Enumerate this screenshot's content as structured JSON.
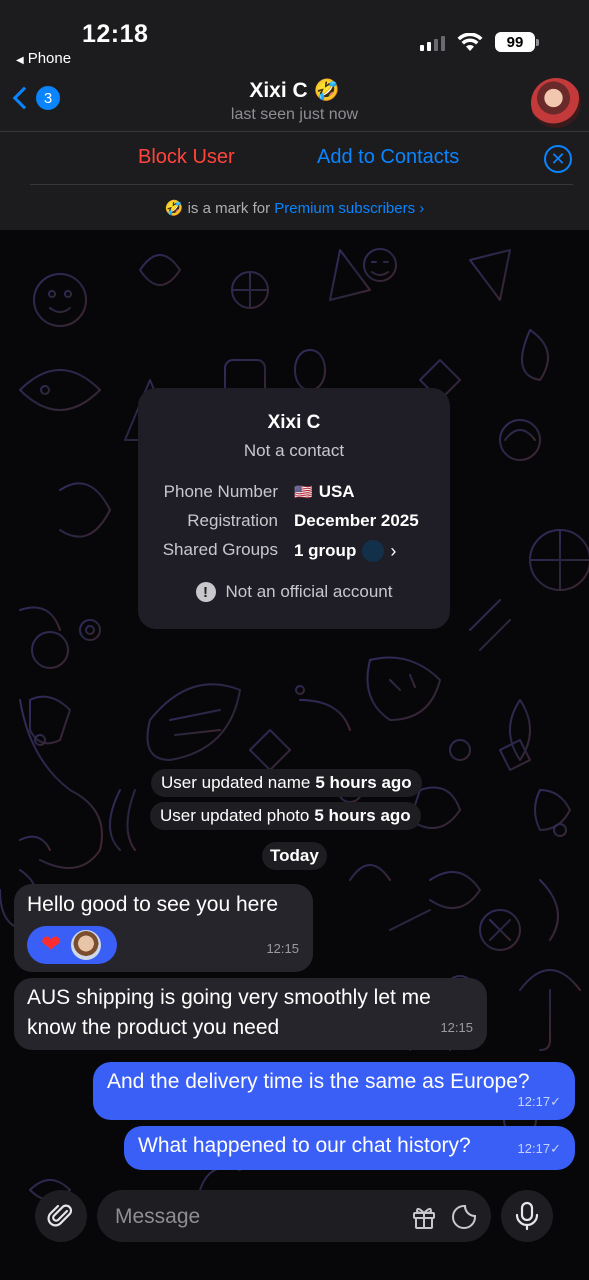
{
  "status_bar": {
    "time": "12:18",
    "back_app": "Phone",
    "battery": "99"
  },
  "header": {
    "unread_count": "3",
    "title": "Xixi C 🤣",
    "subtitle": "last seen just now"
  },
  "actions": {
    "block_label": "Block User",
    "add_label": "Add to Contacts",
    "close_glyph": "✕"
  },
  "premium": {
    "emoji": "🤣",
    "text": "is a mark for",
    "link": "Premium subscribers",
    "arrow": "›"
  },
  "info_card": {
    "name": "Xixi C",
    "status": "Not a contact",
    "rows": [
      {
        "label": "Phone Number",
        "flag": "🇺🇸",
        "value": "USA"
      },
      {
        "label": "Registration",
        "value": "December 2025"
      },
      {
        "label": "Shared Groups",
        "value": "1 group",
        "arrow": "›"
      }
    ],
    "warning": "Not an official account",
    "warning_icon": "!"
  },
  "service_messages": [
    {
      "text": "User updated name",
      "bold": "5 hours ago"
    },
    {
      "text": "User updated photo",
      "bold": "5 hours ago"
    }
  ],
  "date_label": "Today",
  "messages": [
    {
      "direction": "in",
      "text": "Hello good to see you here",
      "time": "12:15",
      "reaction": "❤"
    },
    {
      "direction": "in",
      "text": "AUS shipping is going very smoothly let me know the product you need",
      "time": "12:15"
    },
    {
      "direction": "out",
      "text": "And the delivery time is the same as Europe?",
      "time": "12:17",
      "check": "✓"
    },
    {
      "direction": "out",
      "text": "What happened to our chat history?",
      "time": "12:17",
      "check": "✓"
    }
  ],
  "input": {
    "placeholder": "Message"
  },
  "icons": {
    "attach": "paperclip-icon",
    "gift": "gift-icon",
    "sticker": "sticker-icon",
    "mic": "microphone-icon",
    "warning": "info-icon",
    "close": "close-icon",
    "back": "chevron-left-icon"
  },
  "colors": {
    "accent": "#0a84ff",
    "danger": "#ff453a",
    "outgoing_bubble": "#3a5ff7",
    "incoming_bubble": "#26252b"
  }
}
